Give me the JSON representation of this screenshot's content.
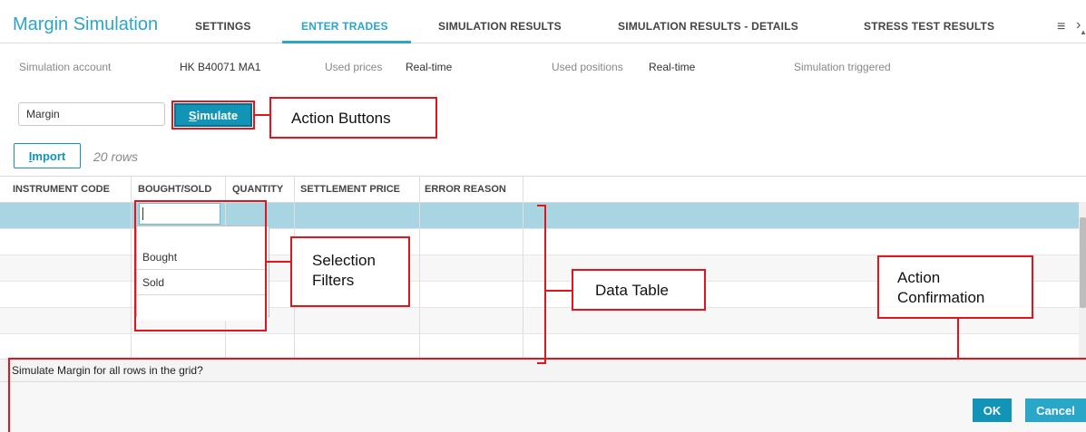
{
  "header": {
    "title": "Margin Simulation",
    "tabs": [
      {
        "label": "SETTINGS"
      },
      {
        "label": "ENTER TRADES"
      },
      {
        "label": "SIMULATION RESULTS"
      },
      {
        "label": "SIMULATION RESULTS - DETAILS"
      },
      {
        "label": "STRESS TEST RESULTS"
      }
    ],
    "active_tab": "ENTER TRADES",
    "menu_icon": "hamburger-icon",
    "close_icon": "close-icon"
  },
  "info": {
    "account_label": "Simulation account",
    "account_value": "HK B40071 MA1",
    "prices_label": "Used prices",
    "prices_value": "Real-time",
    "positions_label": "Used positions",
    "positions_value": "Real-time",
    "triggered_label": "Simulation triggered"
  },
  "simulation": {
    "type_value": "Margin",
    "simulate_prefix": "S",
    "simulate_rest": "imulate"
  },
  "import": {
    "prefix": "I",
    "rest": "mport",
    "rows_count": "20 rows"
  },
  "grid": {
    "columns": [
      "INSTRUMENT CODE",
      "BOUGHT/SOLD",
      "QUANTITY",
      "SETTLEMENT PRICE",
      "ERROR REASON"
    ]
  },
  "dropdown": {
    "options": [
      "",
      "Bought",
      "Sold",
      ""
    ]
  },
  "confirmation": {
    "message": "Simulate Margin for all rows in the grid?",
    "ok_label": "OK",
    "cancel_label": "Cancel"
  },
  "annotations": {
    "action_buttons": "Action Buttons",
    "selection_filters_1": "Selection",
    "selection_filters_2": "Filters",
    "data_table": "Data Table",
    "action_confirmation_1": "Action",
    "action_confirmation_2": "Confirmation"
  },
  "colors": {
    "accent": "#2aa6c9",
    "button": "#1294b7",
    "selected_row": "#a9d4e1",
    "annotation": "#e0161f"
  }
}
